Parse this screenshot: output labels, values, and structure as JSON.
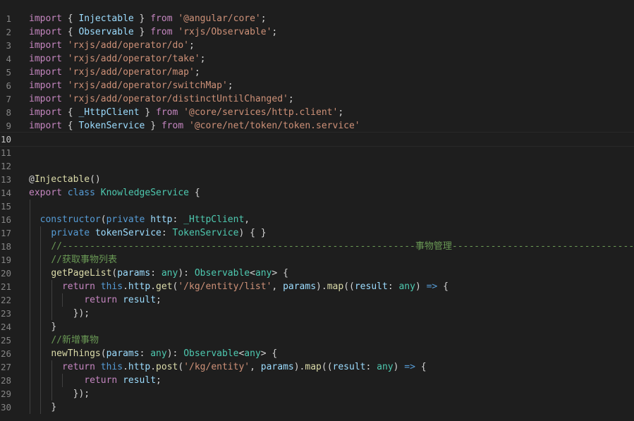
{
  "editor": {
    "language": "typescript",
    "theme": "dark",
    "active_line": 10,
    "colors": {
      "background": "#1e1e1e",
      "line_number": "#858585",
      "keyword": "#569cd6",
      "control": "#c586c0",
      "string": "#ce9178",
      "class": "#4ec9b0",
      "function": "#dcdcaa",
      "variable": "#9cdcfe",
      "comment": "#6a9955"
    },
    "lines": [
      {
        "n": "1",
        "indent": 0,
        "tokens": [
          [
            "import",
            "ctl"
          ],
          [
            " { ",
            "pun"
          ],
          [
            "Injectable",
            "var"
          ],
          [
            " } ",
            "pun"
          ],
          [
            "from",
            "ctl"
          ],
          [
            " ",
            "pun"
          ],
          [
            "'@angular/core'",
            "str"
          ],
          [
            ";",
            "pun"
          ]
        ]
      },
      {
        "n": "2",
        "indent": 0,
        "tokens": [
          [
            "import",
            "ctl"
          ],
          [
            " { ",
            "pun"
          ],
          [
            "Observable",
            "var"
          ],
          [
            " } ",
            "pun"
          ],
          [
            "from",
            "ctl"
          ],
          [
            " ",
            "pun"
          ],
          [
            "'rxjs/Observable'",
            "str"
          ],
          [
            ";",
            "pun"
          ]
        ]
      },
      {
        "n": "3",
        "indent": 0,
        "tokens": [
          [
            "import",
            "ctl"
          ],
          [
            " ",
            "pun"
          ],
          [
            "'rxjs/add/operator/do'",
            "str"
          ],
          [
            ";",
            "pun"
          ]
        ]
      },
      {
        "n": "4",
        "indent": 0,
        "tokens": [
          [
            "import",
            "ctl"
          ],
          [
            " ",
            "pun"
          ],
          [
            "'rxjs/add/operator/take'",
            "str"
          ],
          [
            ";",
            "pun"
          ]
        ]
      },
      {
        "n": "5",
        "indent": 0,
        "tokens": [
          [
            "import",
            "ctl"
          ],
          [
            " ",
            "pun"
          ],
          [
            "'rxjs/add/operator/map'",
            "str"
          ],
          [
            ";",
            "pun"
          ]
        ]
      },
      {
        "n": "6",
        "indent": 0,
        "tokens": [
          [
            "import",
            "ctl"
          ],
          [
            " ",
            "pun"
          ],
          [
            "'rxjs/add/operator/switchMap'",
            "str"
          ],
          [
            ";",
            "pun"
          ]
        ]
      },
      {
        "n": "7",
        "indent": 0,
        "tokens": [
          [
            "import",
            "ctl"
          ],
          [
            " ",
            "pun"
          ],
          [
            "'rxjs/add/operator/distinctUntilChanged'",
            "str"
          ],
          [
            ";",
            "pun"
          ]
        ]
      },
      {
        "n": "8",
        "indent": 0,
        "tokens": [
          [
            "import",
            "ctl"
          ],
          [
            " { ",
            "pun"
          ],
          [
            "_HttpClient",
            "var"
          ],
          [
            " } ",
            "pun"
          ],
          [
            "from",
            "ctl"
          ],
          [
            " ",
            "pun"
          ],
          [
            "'@core/services/http.client'",
            "str"
          ],
          [
            ";",
            "pun"
          ]
        ]
      },
      {
        "n": "9",
        "indent": 0,
        "tokens": [
          [
            "import",
            "ctl"
          ],
          [
            " { ",
            "pun"
          ],
          [
            "TokenService",
            "var"
          ],
          [
            " } ",
            "pun"
          ],
          [
            "from",
            "ctl"
          ],
          [
            " ",
            "pun"
          ],
          [
            "'@core/net/token/token.service'",
            "str"
          ]
        ]
      },
      {
        "n": "10",
        "indent": 0,
        "tokens": []
      },
      {
        "n": "11",
        "indent": 0,
        "tokens": []
      },
      {
        "n": "12",
        "indent": 0,
        "tokens": []
      },
      {
        "n": "13",
        "indent": 0,
        "tokens": [
          [
            "@",
            "pun"
          ],
          [
            "Injectable",
            "fn"
          ],
          [
            "()",
            "pun"
          ]
        ]
      },
      {
        "n": "14",
        "indent": 0,
        "tokens": [
          [
            "export",
            "ctl"
          ],
          [
            " ",
            "pun"
          ],
          [
            "class",
            "kw"
          ],
          [
            " ",
            "pun"
          ],
          [
            "KnowledgeService",
            "cls"
          ],
          [
            " {",
            "pun"
          ]
        ]
      },
      {
        "n": "15",
        "indent": 1,
        "tokens": []
      },
      {
        "n": "16",
        "indent": 1,
        "tokens": [
          [
            "  ",
            "pun"
          ],
          [
            "constructor",
            "kw"
          ],
          [
            "(",
            "pun"
          ],
          [
            "private",
            "kw"
          ],
          [
            " ",
            "pun"
          ],
          [
            "http",
            "var"
          ],
          [
            ": ",
            "pun"
          ],
          [
            "_HttpClient",
            "cls"
          ],
          [
            ",",
            "pun"
          ]
        ]
      },
      {
        "n": "17",
        "indent": 2,
        "tokens": [
          [
            "    ",
            "pun"
          ],
          [
            "private",
            "kw"
          ],
          [
            " ",
            "pun"
          ],
          [
            "tokenService",
            "var"
          ],
          [
            ": ",
            "pun"
          ],
          [
            "TokenService",
            "cls"
          ],
          [
            ") { }",
            "pun"
          ]
        ]
      },
      {
        "n": "18",
        "indent": 2,
        "tokens": [
          [
            "    ",
            "pun"
          ],
          [
            "//----------------------------------------------------------------事物管理---------------------------------",
            "com"
          ]
        ]
      },
      {
        "n": "19",
        "indent": 2,
        "tokens": [
          [
            "    ",
            "pun"
          ],
          [
            "//获取事物列表",
            "com"
          ]
        ]
      },
      {
        "n": "20",
        "indent": 2,
        "tokens": [
          [
            "    ",
            "pun"
          ],
          [
            "getPageList",
            "fn"
          ],
          [
            "(",
            "pun"
          ],
          [
            "params",
            "var"
          ],
          [
            ": ",
            "pun"
          ],
          [
            "any",
            "cls"
          ],
          [
            "): ",
            "pun"
          ],
          [
            "Observable",
            "cls"
          ],
          [
            "<",
            "pun"
          ],
          [
            "any",
            "cls"
          ],
          [
            "> {",
            "pun"
          ]
        ]
      },
      {
        "n": "21",
        "indent": 3,
        "tokens": [
          [
            "      ",
            "pun"
          ],
          [
            "return",
            "ctl"
          ],
          [
            " ",
            "pun"
          ],
          [
            "this",
            "kw"
          ],
          [
            ".",
            "pun"
          ],
          [
            "http",
            "var"
          ],
          [
            ".",
            "pun"
          ],
          [
            "get",
            "fn"
          ],
          [
            "(",
            "pun"
          ],
          [
            "'/kg/entity/list'",
            "str"
          ],
          [
            ", ",
            "pun"
          ],
          [
            "params",
            "var"
          ],
          [
            ").",
            "pun"
          ],
          [
            "map",
            "fn"
          ],
          [
            "((",
            "pun"
          ],
          [
            "result",
            "var"
          ],
          [
            ": ",
            "pun"
          ],
          [
            "any",
            "cls"
          ],
          [
            ") ",
            "pun"
          ],
          [
            "=>",
            "kw"
          ],
          [
            " {",
            "pun"
          ]
        ]
      },
      {
        "n": "22",
        "indent": 4,
        "tokens": [
          [
            "          ",
            "pun"
          ],
          [
            "return",
            "ctl"
          ],
          [
            " ",
            "pun"
          ],
          [
            "result",
            "var"
          ],
          [
            ";",
            "pun"
          ]
        ]
      },
      {
        "n": "23",
        "indent": 3,
        "tokens": [
          [
            "        ",
            "pun"
          ],
          [
            "});",
            "pun"
          ]
        ]
      },
      {
        "n": "24",
        "indent": 2,
        "tokens": [
          [
            "    ",
            "pun"
          ],
          [
            "}",
            "pun"
          ]
        ]
      },
      {
        "n": "25",
        "indent": 2,
        "tokens": [
          [
            "    ",
            "pun"
          ],
          [
            "//新增事物",
            "com"
          ]
        ]
      },
      {
        "n": "26",
        "indent": 2,
        "tokens": [
          [
            "    ",
            "pun"
          ],
          [
            "newThings",
            "fn"
          ],
          [
            "(",
            "pun"
          ],
          [
            "params",
            "var"
          ],
          [
            ": ",
            "pun"
          ],
          [
            "any",
            "cls"
          ],
          [
            "): ",
            "pun"
          ],
          [
            "Observable",
            "cls"
          ],
          [
            "<",
            "pun"
          ],
          [
            "any",
            "cls"
          ],
          [
            "> {",
            "pun"
          ]
        ]
      },
      {
        "n": "27",
        "indent": 3,
        "tokens": [
          [
            "      ",
            "pun"
          ],
          [
            "return",
            "ctl"
          ],
          [
            " ",
            "pun"
          ],
          [
            "this",
            "kw"
          ],
          [
            ".",
            "pun"
          ],
          [
            "http",
            "var"
          ],
          [
            ".",
            "pun"
          ],
          [
            "post",
            "fn"
          ],
          [
            "(",
            "pun"
          ],
          [
            "'/kg/entity'",
            "str"
          ],
          [
            ", ",
            "pun"
          ],
          [
            "params",
            "var"
          ],
          [
            ").",
            "pun"
          ],
          [
            "map",
            "fn"
          ],
          [
            "((",
            "pun"
          ],
          [
            "result",
            "var"
          ],
          [
            ": ",
            "pun"
          ],
          [
            "any",
            "cls"
          ],
          [
            ") ",
            "pun"
          ],
          [
            "=>",
            "kw"
          ],
          [
            " {",
            "pun"
          ]
        ]
      },
      {
        "n": "28",
        "indent": 4,
        "tokens": [
          [
            "          ",
            "pun"
          ],
          [
            "return",
            "ctl"
          ],
          [
            " ",
            "pun"
          ],
          [
            "result",
            "var"
          ],
          [
            ";",
            "pun"
          ]
        ]
      },
      {
        "n": "29",
        "indent": 3,
        "tokens": [
          [
            "        ",
            "pun"
          ],
          [
            "});",
            "pun"
          ]
        ]
      },
      {
        "n": "30",
        "indent": 2,
        "tokens": [
          [
            "    ",
            "pun"
          ],
          [
            "}",
            "pun"
          ]
        ]
      }
    ]
  }
}
